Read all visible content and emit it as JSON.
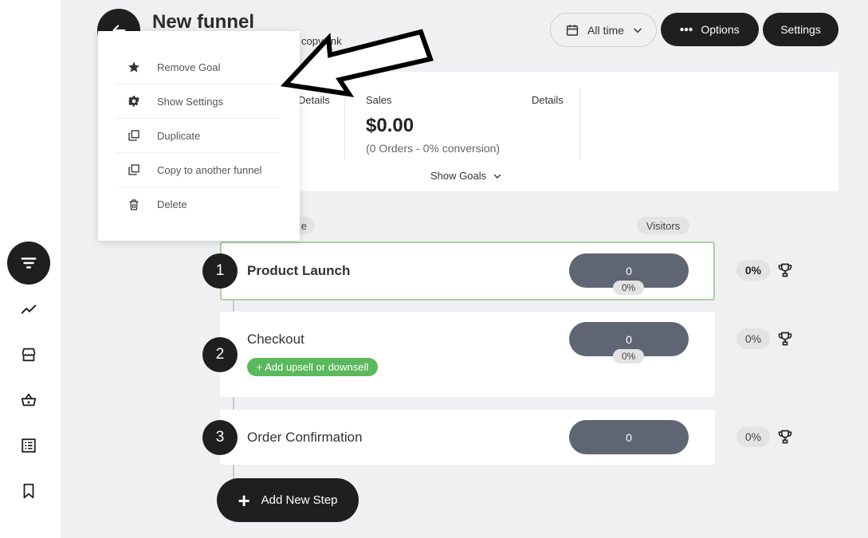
{
  "page": {
    "title": "New funnel",
    "copy_link": "copy link"
  },
  "header": {
    "date_label": "All time",
    "options_label": "Options",
    "settings_label": "Settings"
  },
  "stats": {
    "details_left": "Details",
    "sales_label": "Sales",
    "sales_details": "Details",
    "sales_value": "$0.00",
    "sales_sub": "(0 Orders - 0% conversion)",
    "show_goals": "Show Goals"
  },
  "columns": {
    "name_pill": "e",
    "visitors": "Visitors"
  },
  "steps": [
    {
      "num": "1",
      "name": "Product Launch",
      "visitors": "0",
      "mini": "0%",
      "conv": "0%"
    },
    {
      "num": "2",
      "name": "Checkout",
      "visitors": "0",
      "mini": "0%",
      "conv": "0%",
      "upsell": "+ Add upsell or downsell"
    },
    {
      "num": "3",
      "name": "Order Confirmation",
      "visitors": "0",
      "conv": "0%"
    }
  ],
  "add_step_label": "Add New Step",
  "menu": {
    "items": [
      {
        "label": "Remove Goal",
        "icon": "star-icon"
      },
      {
        "label": "Show Settings",
        "icon": "gear-icon"
      },
      {
        "label": "Duplicate",
        "icon": "copy-icon"
      },
      {
        "label": "Copy to another funnel",
        "icon": "copy-icon"
      },
      {
        "label": "Delete",
        "icon": "trash-icon"
      }
    ]
  },
  "colors": {
    "dark": "#1f1f1f",
    "visitor_pill": "#606573",
    "upsell_green": "#5cb85c",
    "active_border": "#a9d3a3"
  }
}
